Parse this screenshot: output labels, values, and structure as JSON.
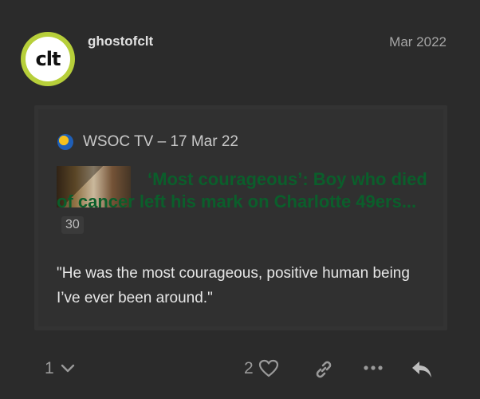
{
  "post": {
    "username": "ghostofclt",
    "avatar_text": "clt",
    "date": "Mar 2022"
  },
  "onebox": {
    "source": "WSOC TV – 17 Mar 22",
    "favicon_icon": "wsoc-logo-icon",
    "title": "‘Most courageous’: Boy who died of cancer left his mark on Charlotte 49ers...",
    "click_count": "30",
    "excerpt": "\"He was the most courageous, positive human being I’ve ever been around.\""
  },
  "actions": {
    "replies_count": "1",
    "likes_count": "2",
    "icons": [
      "chevron-down-icon",
      "heart-icon",
      "link-icon",
      "more-icon",
      "reply-icon"
    ]
  },
  "colors": {
    "background": "#2b2b2b",
    "link": "#0b5e2b",
    "avatar_ring": "#b7cf3a"
  }
}
